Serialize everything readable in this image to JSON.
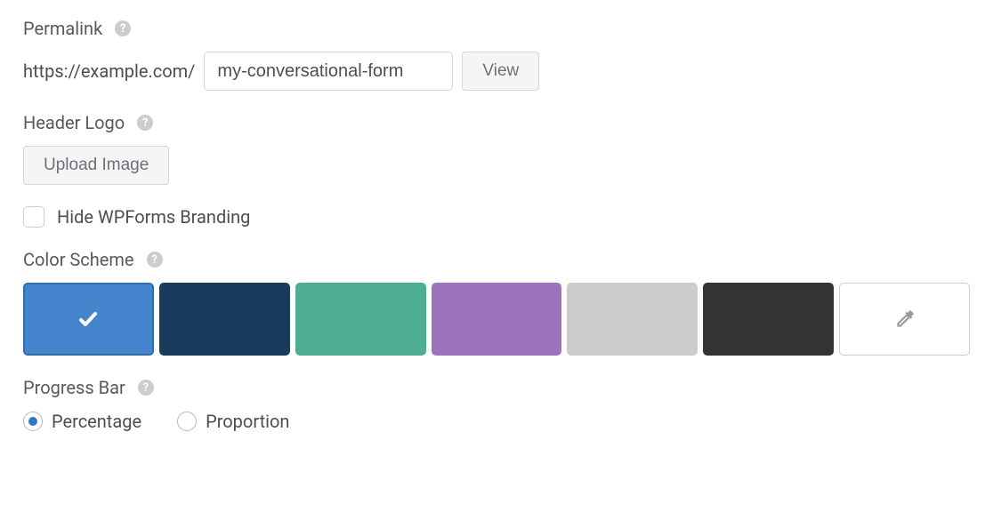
{
  "permalink": {
    "label": "Permalink",
    "prefix": "https://example.com/",
    "slug": "my-conversational-form",
    "view_button": "View"
  },
  "header_logo": {
    "label": "Header Logo",
    "upload_button": "Upload Image"
  },
  "branding": {
    "checkbox_label": "Hide WPForms Branding",
    "checked": false
  },
  "color_scheme": {
    "label": "Color Scheme",
    "colors": [
      {
        "hex": "#4585cd",
        "selected": true
      },
      {
        "hex": "#1a3c5c",
        "selected": false
      },
      {
        "hex": "#4eae94",
        "selected": false
      },
      {
        "hex": "#9b74bb",
        "selected": false
      },
      {
        "hex": "#cccccc",
        "selected": false
      },
      {
        "hex": "#333333",
        "selected": false
      }
    ]
  },
  "progress_bar": {
    "label": "Progress Bar",
    "options": [
      {
        "label": "Percentage",
        "value": "percentage",
        "checked": true
      },
      {
        "label": "Proportion",
        "value": "proportion",
        "checked": false
      }
    ]
  }
}
